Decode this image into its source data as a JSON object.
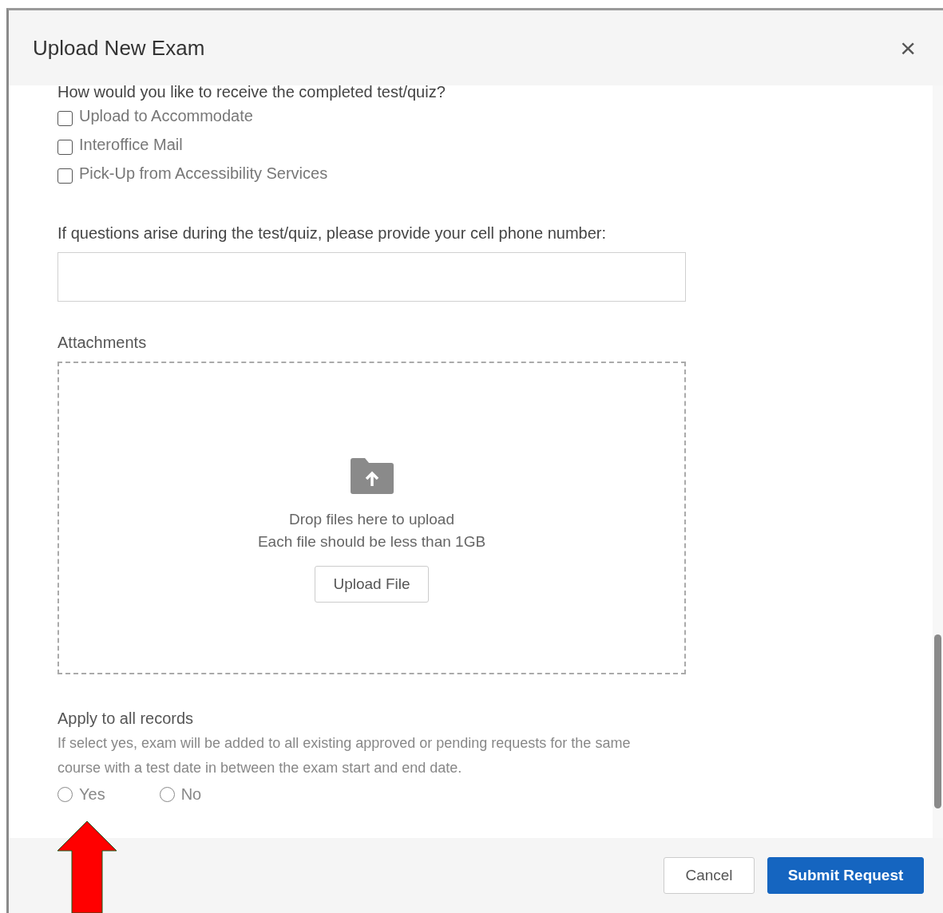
{
  "dialog": {
    "title": "Upload New Exam",
    "close": "×"
  },
  "delivery": {
    "question": "How would you like to receive the completed test/quiz?",
    "options": [
      {
        "label": "Upload to Accommodate",
        "checked": false
      },
      {
        "label": "Interoffice Mail",
        "checked": false
      },
      {
        "label": "Pick-Up from Accessibility Services",
        "checked": false
      }
    ]
  },
  "phone": {
    "label": "If questions arise during the test/quiz, please provide your cell phone number:"
  },
  "attachments": {
    "label": "Attachments",
    "drop_text": "Drop files here to upload",
    "size_hint": "Each file should be less than 1GB",
    "button": "Upload File"
  },
  "apply": {
    "label": "Apply to all records",
    "description": "If select yes, exam will be added to all existing approved or pending requests for the same course with a test date in between the exam start and end date.",
    "options": [
      {
        "label": "Yes",
        "selected": false
      },
      {
        "label": "No",
        "selected": false
      }
    ]
  },
  "footer": {
    "buttons": [
      {
        "label": "Cancel",
        "kind": "secondary"
      },
      {
        "label": "Submit Request",
        "kind": "primary"
      }
    ]
  }
}
